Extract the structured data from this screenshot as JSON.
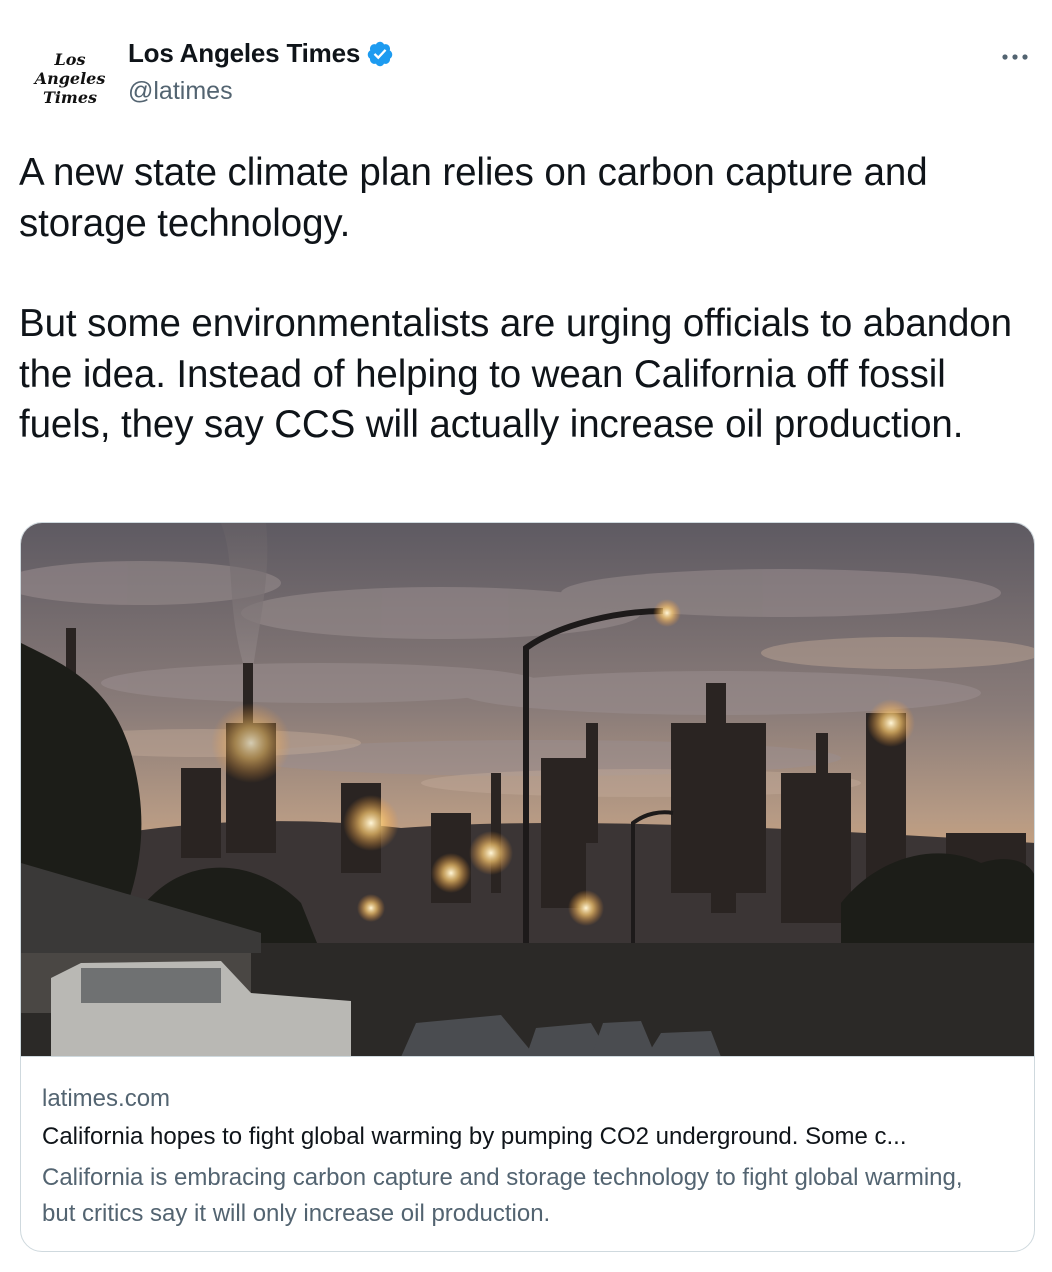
{
  "author": {
    "avatar_lines": [
      "Los",
      "Angeles",
      "Times"
    ],
    "display_name": "Los Angeles Times",
    "handle": "@latimes",
    "verified_icon": "verified-badge-icon"
  },
  "more_icon": "more-options-icon",
  "tweet": {
    "paragraph_1": "A new state climate plan relies on carbon capture and storage technology.",
    "paragraph_2": "But some environmentalists are urging officials to abandon the idea. Instead of helping to wean California off fossil fuels, they say CCS will actually increase oil production."
  },
  "card": {
    "domain": "latimes.com",
    "title": "California hopes to fight global warming by pumping CO2 underground. Some c...",
    "description": "California is embracing carbon capture and storage technology to fight global warming, but critics say it will only increase oil production."
  },
  "colors": {
    "text_primary": "#0f1419",
    "text_secondary": "#536471",
    "border": "#cfd9de",
    "verified_blue": "#1d9bf0"
  }
}
